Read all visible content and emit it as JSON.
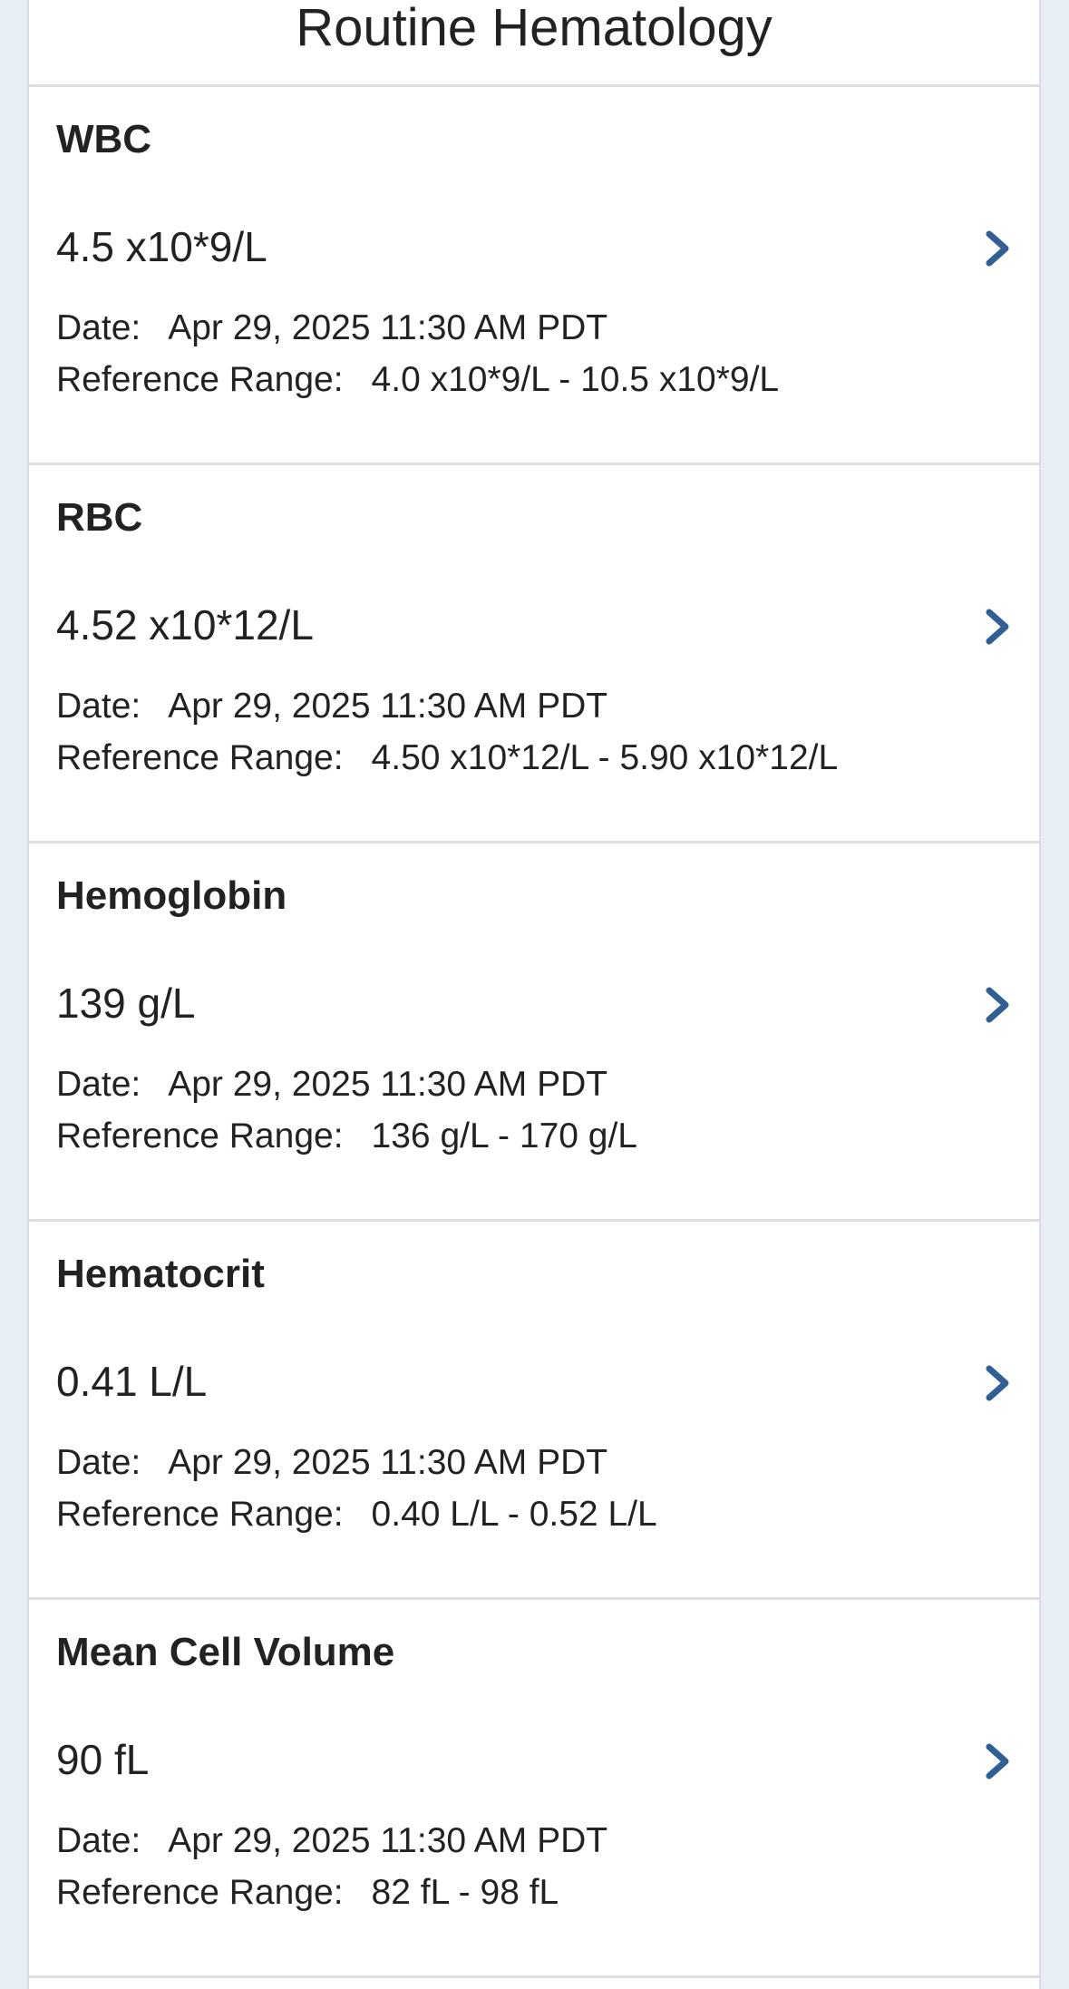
{
  "header": {
    "title": "Routine Hematology"
  },
  "labels": {
    "date": "Date:",
    "reference_range": "Reference Range:"
  },
  "colors": {
    "chevron": "#2f5f94",
    "divider": "#dcdfe3",
    "background": "#e8eef5"
  },
  "results": [
    {
      "name": "WBC",
      "value": "4.5 x10*9/L",
      "date": "Apr 29, 2025 11:30 AM PDT",
      "reference_range": "4.0 x10*9/L - 10.5 x10*9/L",
      "icon": "chevron-right-icon"
    },
    {
      "name": "RBC",
      "value": "4.52 x10*12/L",
      "date": "Apr 29, 2025 11:30 AM PDT",
      "reference_range": "4.50 x10*12/L - 5.90 x10*12/L",
      "icon": "chevron-right-icon"
    },
    {
      "name": "Hemoglobin",
      "value": "139 g/L",
      "date": "Apr 29, 2025 11:30 AM PDT",
      "reference_range": "136 g/L - 170 g/L",
      "icon": "chevron-right-icon"
    },
    {
      "name": "Hematocrit",
      "value": "0.41 L/L",
      "date": "Apr 29, 2025 11:30 AM PDT",
      "reference_range": "0.40 L/L - 0.52 L/L",
      "icon": "chevron-right-icon"
    },
    {
      "name": "Mean Cell Volume",
      "value": "90 fL",
      "date": "Apr 29, 2025 11:30 AM PDT",
      "reference_range": "82 fL - 98 fL",
      "icon": "chevron-right-icon"
    }
  ]
}
